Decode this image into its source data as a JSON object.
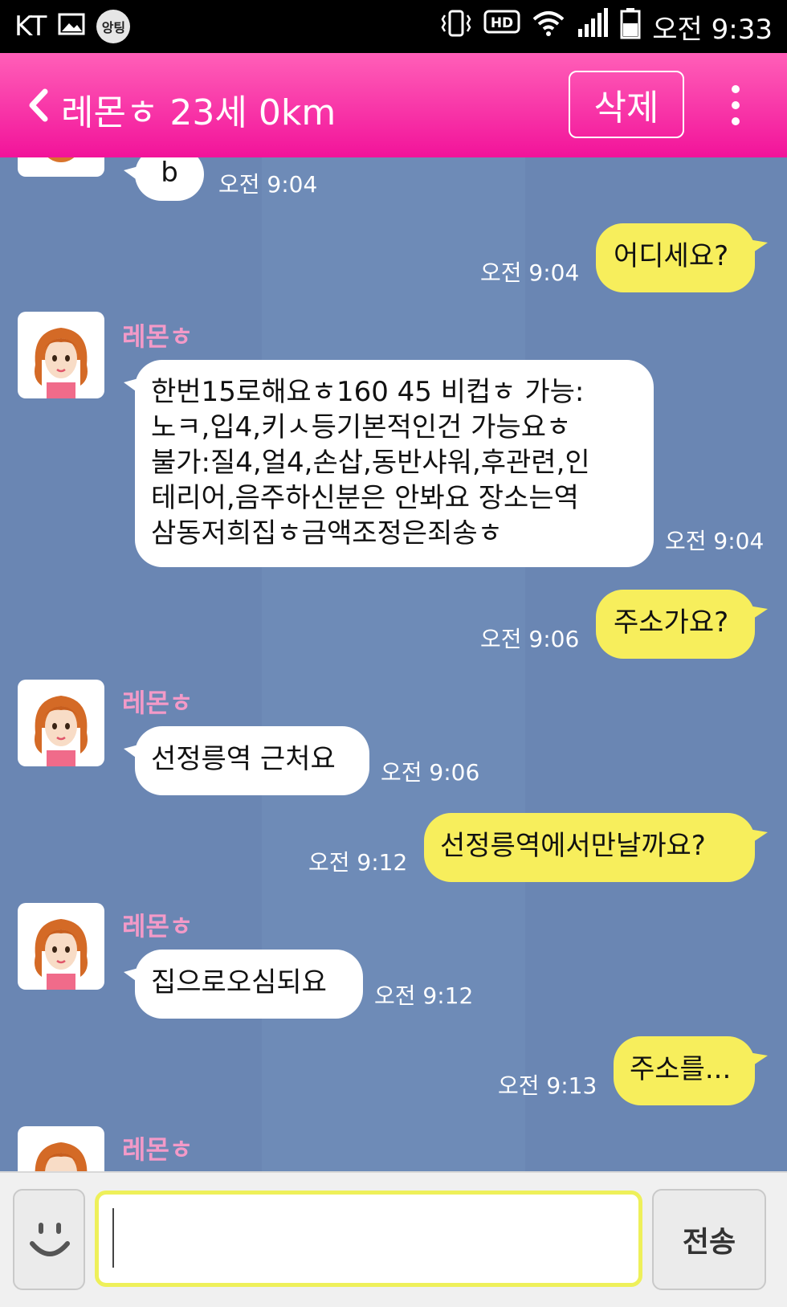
{
  "status_bar": {
    "carrier": "KT",
    "app_badge": "앙팅",
    "time": "오전 9:33",
    "icons": [
      "image-icon",
      "app-badge-icon",
      "vibrate-icon",
      "hd-icon",
      "wifi-icon",
      "signal-icon",
      "battery-icon"
    ]
  },
  "header": {
    "title": "레몬ㅎ 23세 0km",
    "delete_label": "삭제",
    "accent_color": "#f2139a"
  },
  "messages": [
    {
      "side": "in",
      "text": "b",
      "time": "오전 9:04"
    },
    {
      "side": "out",
      "text": "어디세요?",
      "time": "오전 9:04"
    },
    {
      "side": "in",
      "sender": "레몬ㅎ",
      "lines": [
        "한번15로해요ㅎ160 45 비컵ㅎ 가능:",
        "노ㅋ,입4,키ㅅ등기본적인건 가능요ㅎ",
        "불가:질4,얼4,손삽,동반샤워,후관련,인",
        "테리어,음주하신분은 안봐요 장소는역",
        "삼동저희집ㅎ금액조정은죄송ㅎ"
      ],
      "time": "오전 9:04"
    },
    {
      "side": "out",
      "text": "주소가요?",
      "time": "오전 9:06"
    },
    {
      "side": "in",
      "sender": "레몬ㅎ",
      "text": "선정릉역 근처요",
      "time": "오전 9:06"
    },
    {
      "side": "out",
      "text": "선정릉역에서만날까요?",
      "time": "오전 9:12"
    },
    {
      "side": "in",
      "sender": "레몬ㅎ",
      "text": "집으로오심되요",
      "time": "오전 9:12"
    },
    {
      "side": "out",
      "text": "주소를...",
      "time": "오전 9:13"
    },
    {
      "side": "in",
      "sender": "레몬ㅎ"
    }
  ],
  "input": {
    "value": "",
    "send_label": "전송"
  }
}
